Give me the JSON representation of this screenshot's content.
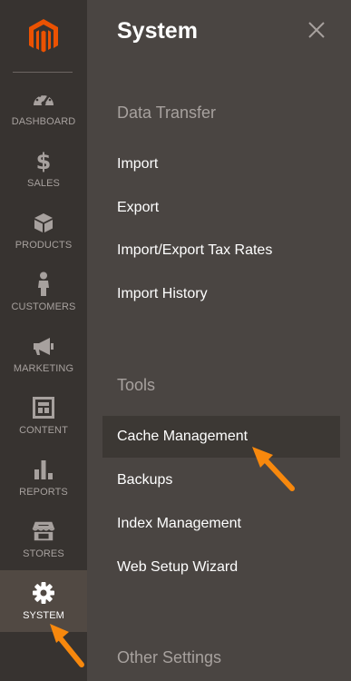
{
  "colors": {
    "brand_orange": "#eb5202",
    "sidebar_bg": "#373330",
    "panel_bg": "#4a4542",
    "active_bg": "#514943",
    "annotation_arrow": "#f7880d"
  },
  "sidebar": {
    "logo_icon": "magento-logo-icon",
    "items": [
      {
        "label": "DASHBOARD",
        "icon": "dashboard-gauge-icon"
      },
      {
        "label": "SALES",
        "icon": "dollar-icon"
      },
      {
        "label": "PRODUCTS",
        "icon": "cube-icon"
      },
      {
        "label": "CUSTOMERS",
        "icon": "person-icon"
      },
      {
        "label": "MARKETING",
        "icon": "megaphone-icon"
      },
      {
        "label": "CONTENT",
        "icon": "layout-icon"
      },
      {
        "label": "REPORTS",
        "icon": "bar-chart-icon"
      },
      {
        "label": "STORES",
        "icon": "storefront-icon"
      },
      {
        "label": "SYSTEM",
        "icon": "gear-icon",
        "active": true
      }
    ]
  },
  "panel": {
    "title": "System",
    "close_icon": "close-icon",
    "sections": [
      {
        "title": "Data Transfer",
        "links": [
          "Import",
          "Export",
          "Import/Export Tax Rates",
          "Import History"
        ]
      },
      {
        "title": "Tools",
        "links": [
          "Cache Management",
          "Backups",
          "Index Management",
          "Web Setup Wizard"
        ]
      },
      {
        "title": "Other Settings",
        "links": []
      }
    ],
    "highlighted_link": "Cache Management"
  }
}
